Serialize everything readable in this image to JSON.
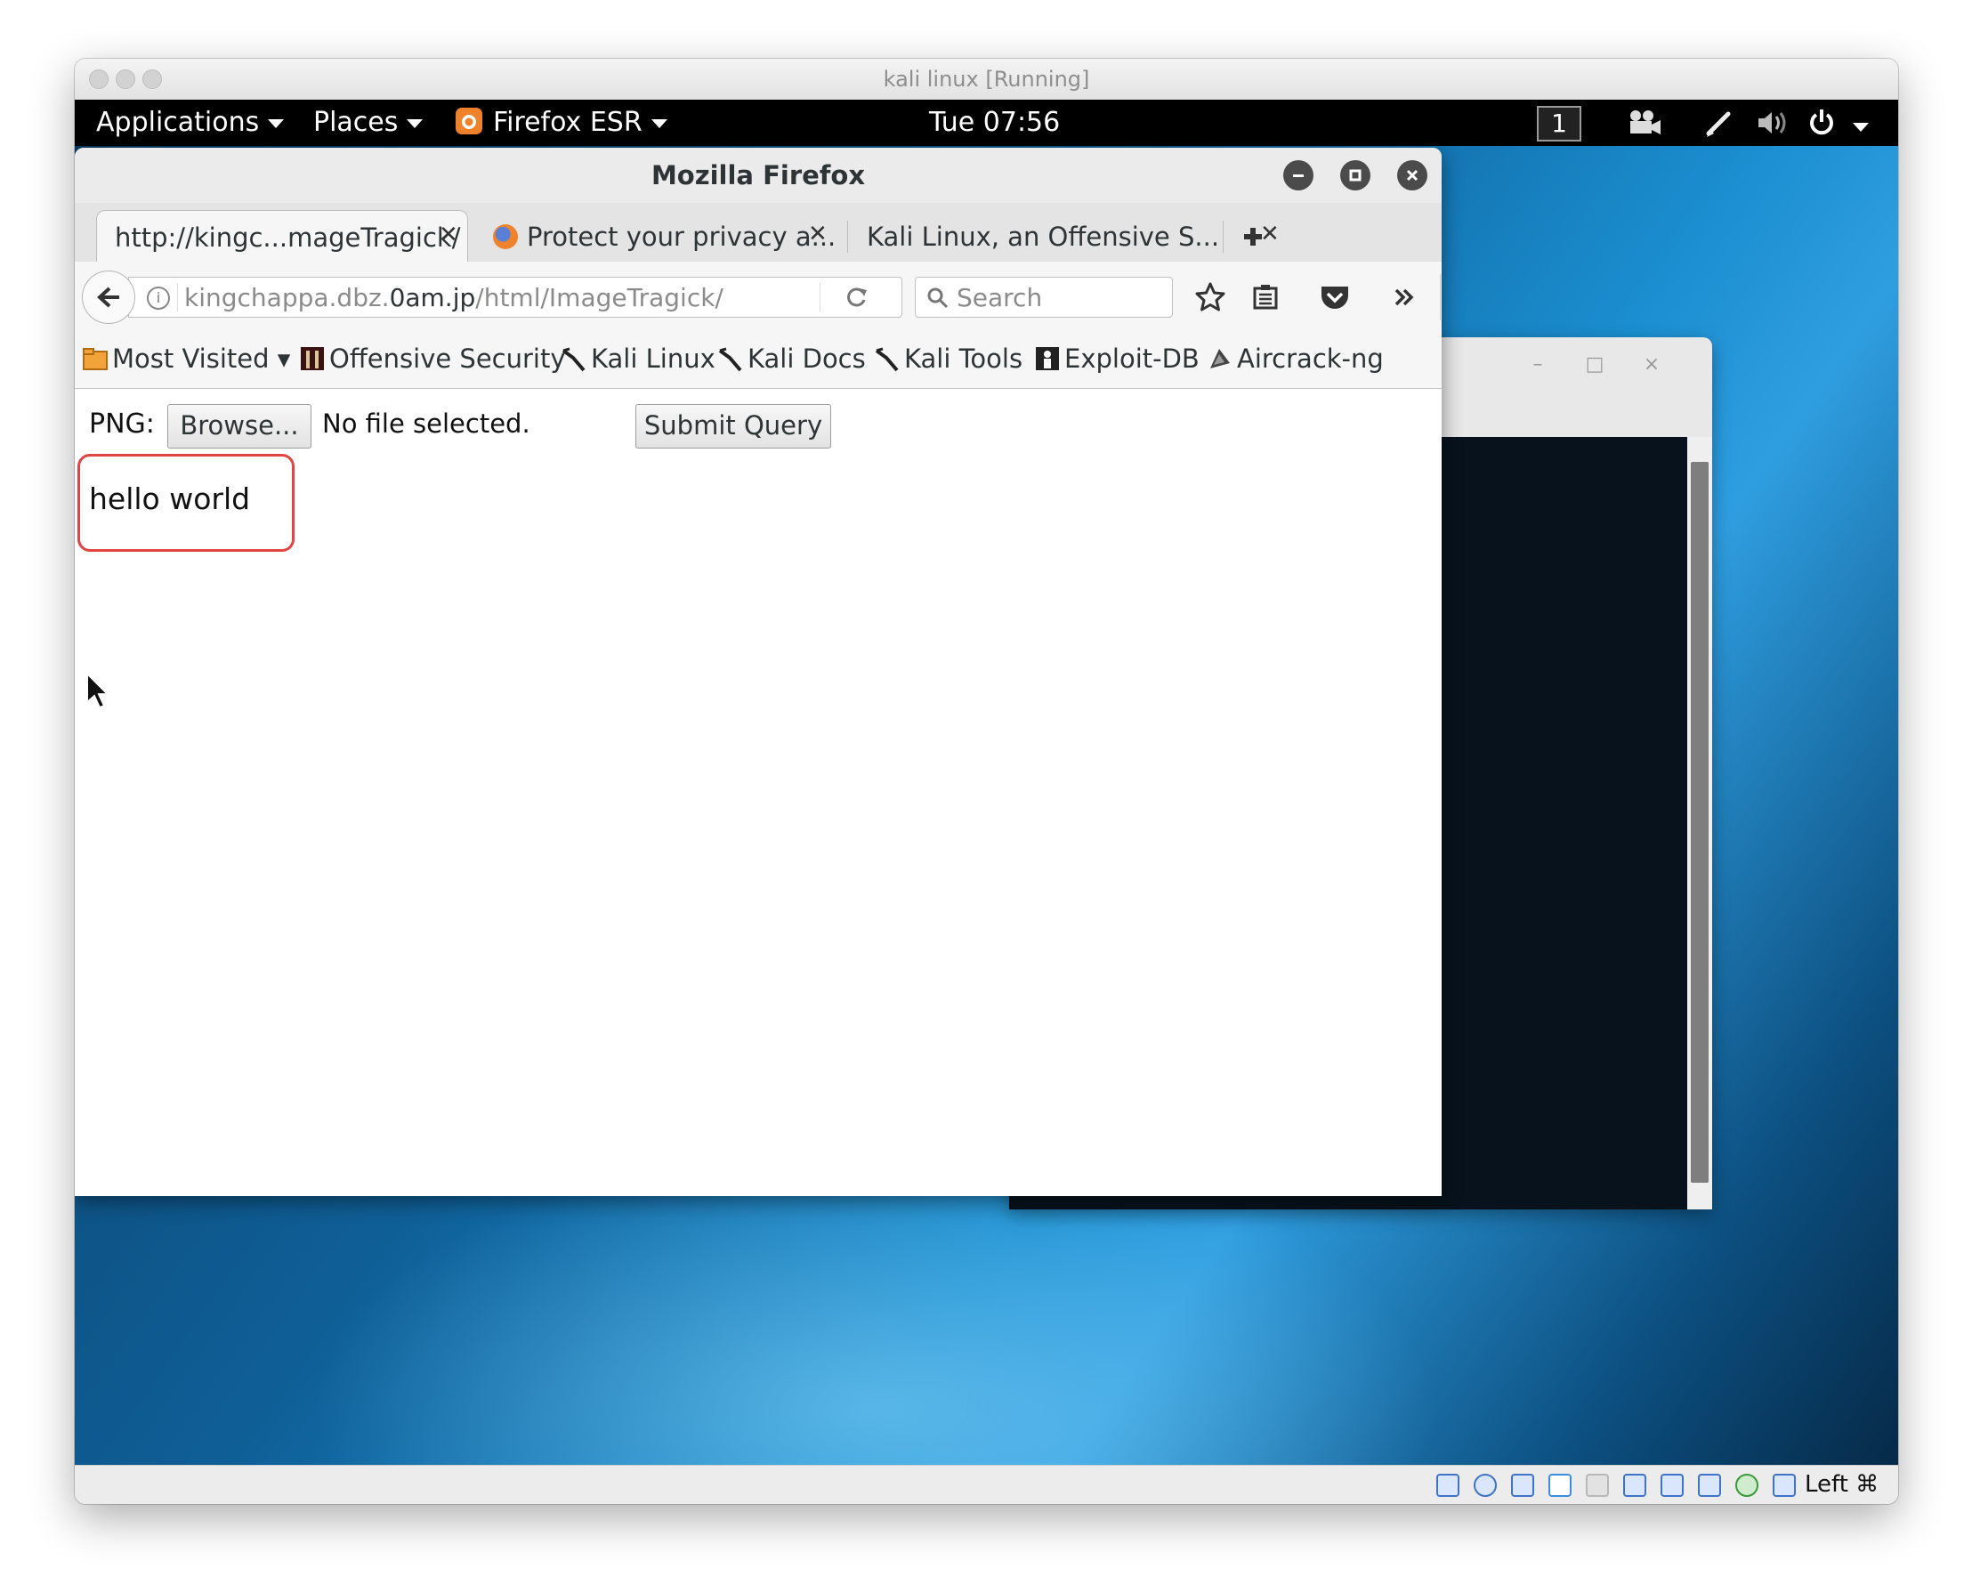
{
  "vm": {
    "title": "kali linux [Running]",
    "host_key_label": "Left ⌘"
  },
  "topbar": {
    "applications": "Applications",
    "places": "Places",
    "firefox": "Firefox ESR",
    "clock": "Tue 07:56",
    "workspace": "1"
  },
  "firefox": {
    "window_title": "Mozilla Firefox",
    "tabs": [
      {
        "label": "http://kingc...mageTragick/",
        "active": true
      },
      {
        "label": "Protect your privacy a...",
        "active": false
      },
      {
        "label": "Kali Linux, an Offensive S...",
        "active": false
      }
    ],
    "url": {
      "prefix": "kingchappa.dbz.",
      "host": "0am.jp",
      "path": "/html/ImageTragick/"
    },
    "search_placeholder": "Search",
    "bookmarks": [
      {
        "label": "Most Visited ▾",
        "icon": "folder-icon"
      },
      {
        "label": "Offensive Security",
        "icon": "offsec-icon"
      },
      {
        "label": "Kali Linux",
        "icon": "kali-dragon-icon"
      },
      {
        "label": "Kali Docs",
        "icon": "kali-dragon-icon"
      },
      {
        "label": "Kali Tools",
        "icon": "kali-dragon-icon"
      },
      {
        "label": "Exploit-DB",
        "icon": "exploitdb-icon"
      },
      {
        "label": "Aircrack-ng",
        "icon": "aircrack-icon"
      }
    ]
  },
  "page": {
    "png_label": "PNG:",
    "browse_label": "Browse...",
    "file_status": "No file selected.",
    "submit_label": "Submit Query",
    "output_text": "hello world"
  },
  "colors": {
    "highlight": "#e24343",
    "firefox_icon": "#f0822b"
  }
}
